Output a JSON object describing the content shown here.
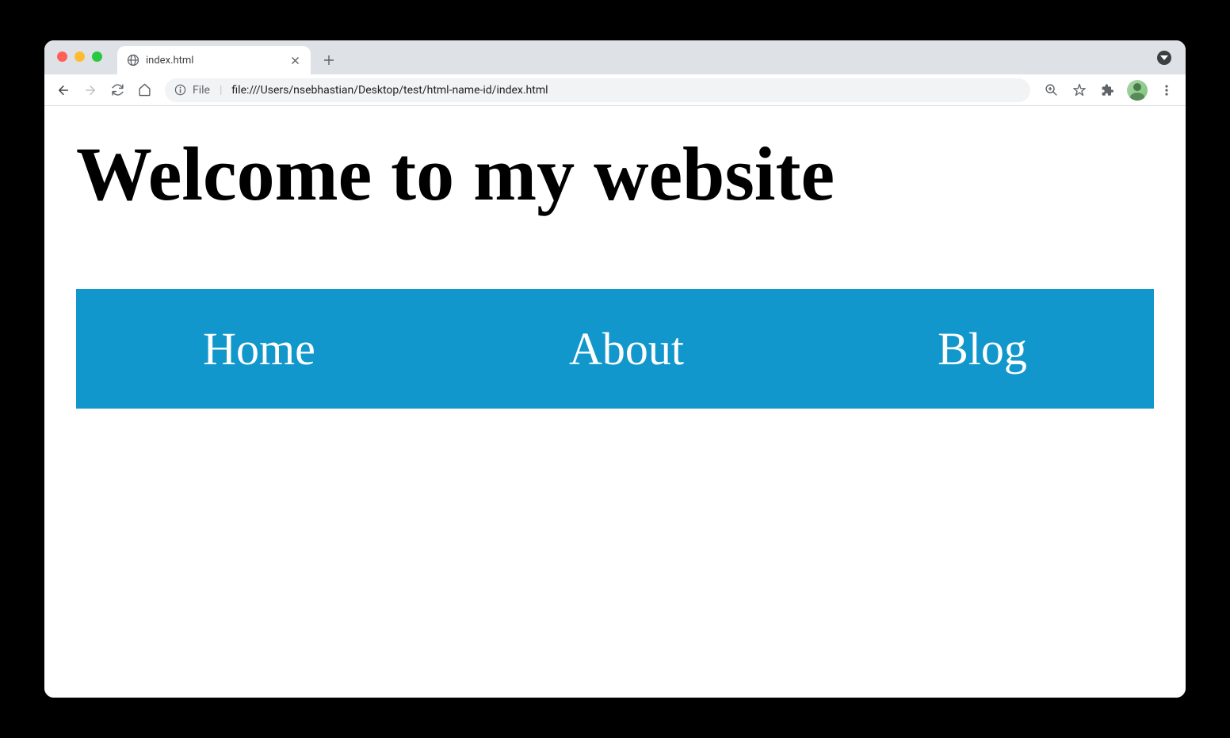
{
  "browser": {
    "tab": {
      "title": "index.html"
    },
    "address": {
      "scheme": "File",
      "path": "file:///Users/nsebhastian/Desktop/test/html-name-id/index.html"
    }
  },
  "page": {
    "heading": "Welcome to my website",
    "nav": {
      "items": [
        {
          "label": "Home"
        },
        {
          "label": "About"
        },
        {
          "label": "Blog"
        }
      ]
    }
  },
  "colors": {
    "navBackground": "#1197cb",
    "navText": "#ffffff"
  }
}
